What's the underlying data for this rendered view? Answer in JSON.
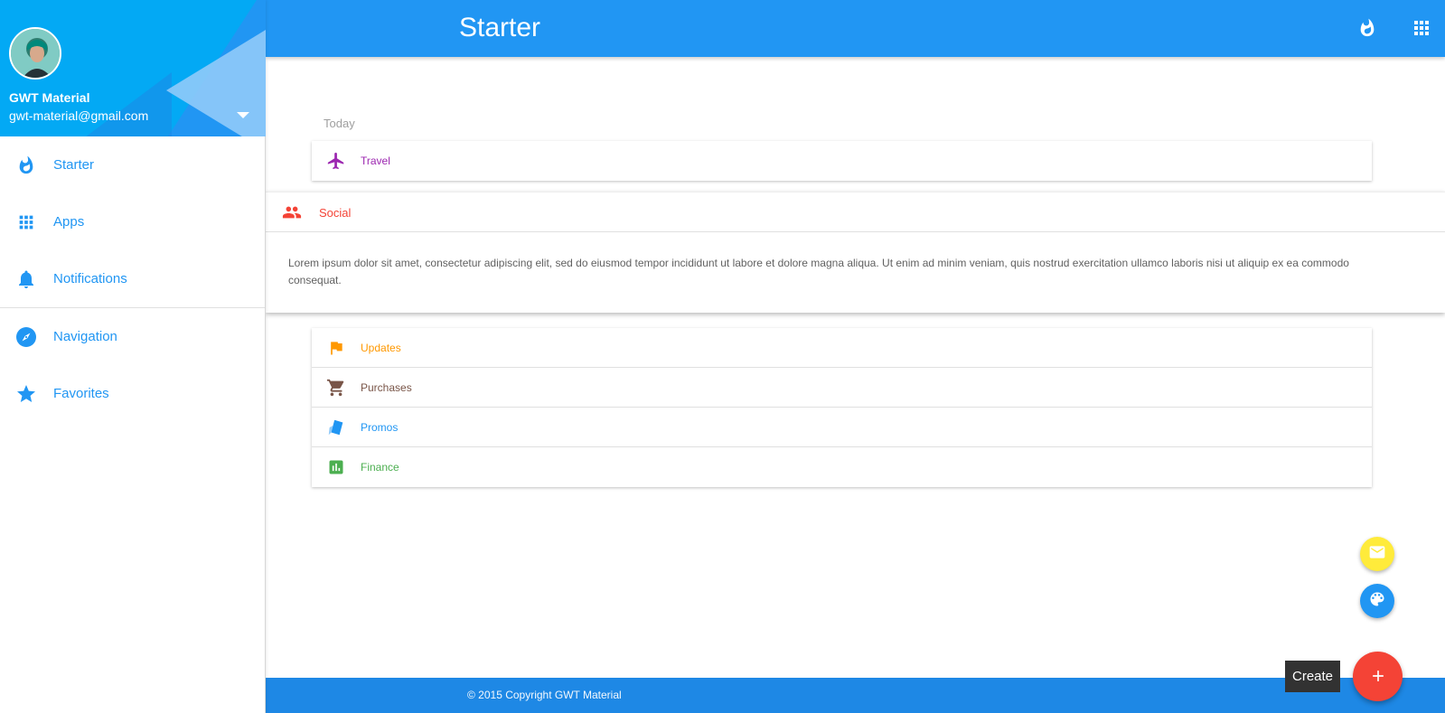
{
  "colors": {
    "primary": "#2196f3",
    "header_bg": "#03a9f4",
    "footer_bg": "#1e88e5",
    "fab_red": "#f44336",
    "fab_yellow": "#ffeb3b",
    "travel": "#9c27b0",
    "social": "#f44336",
    "updates": "#ff9800",
    "purchases": "#795548",
    "promos": "#2196f3",
    "finance": "#4caf50"
  },
  "user": {
    "name": "GWT Material",
    "email": "gwt-material@gmail.com"
  },
  "sidebar": {
    "items": [
      {
        "label": "Starter",
        "icon": "whatshot-icon"
      },
      {
        "label": "Apps",
        "icon": "apps-grid-icon"
      },
      {
        "label": "Notifications",
        "icon": "bell-icon"
      },
      {
        "label": "Navigation",
        "icon": "compass-icon"
      },
      {
        "label": "Favorites",
        "icon": "star-icon"
      }
    ]
  },
  "topbar": {
    "title": "Starter",
    "icons": [
      "whatshot-icon",
      "apps-grid-icon",
      "bell-icon"
    ]
  },
  "main": {
    "section_label": "Today",
    "travel": {
      "label": "Travel",
      "icon": "airplane-icon"
    },
    "social": {
      "label": "Social",
      "icon": "people-icon",
      "body": "Lorem ipsum dolor sit amet, consectetur adipiscing elit, sed do eiusmod tempor incididunt ut labore et dolore magna aliqua. Ut enim ad minim veniam, quis nostrud exercitation ullamco laboris nisi ut aliquip ex ea commodo consequat."
    },
    "list": [
      {
        "label": "Updates",
        "icon": "flag-icon"
      },
      {
        "label": "Purchases",
        "icon": "cart-icon"
      },
      {
        "label": "Promos",
        "icon": "tag-icon"
      },
      {
        "label": "Finance",
        "icon": "chart-icon"
      }
    ]
  },
  "fab": {
    "tooltip": "Create",
    "main_icon": "plus-icon",
    "small_icons": [
      "mail-icon",
      "palette-icon"
    ]
  },
  "footer": {
    "copyright": "© 2015 Copyright GWT Material"
  }
}
